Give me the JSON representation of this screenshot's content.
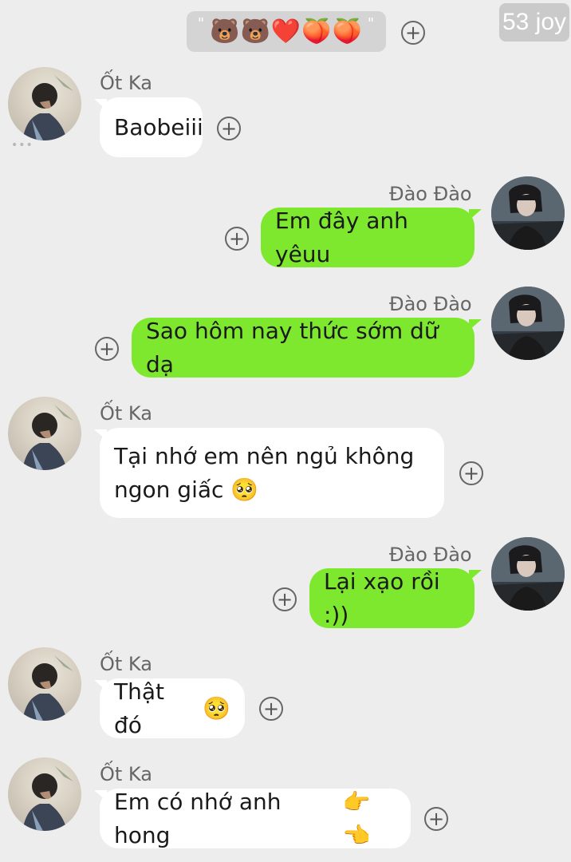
{
  "pinned": {
    "quote_open": "\"",
    "emojis": [
      "🐻",
      "🐻",
      "❤️",
      "🍑",
      "🍑"
    ],
    "quote_close": "\""
  },
  "watermark": {
    "text": "53 joy"
  },
  "contacts": {
    "left_name": "Ốt Ka",
    "right_name": "Đào Đào"
  },
  "messages": [
    {
      "from": "left",
      "name": "Ốt Ka",
      "text": "Baobeiii"
    },
    {
      "from": "right",
      "name": "Đào Đào",
      "text": "Em đây anh yêuu"
    },
    {
      "from": "right",
      "name": "Đào Đào",
      "text": "Sao hôm nay thức sớm dữ dạ"
    },
    {
      "from": "left",
      "name": "Ốt Ka",
      "line1": "Tại nhớ em nên ngủ không",
      "line2": "ngon giấc",
      "emoji": "🥺"
    },
    {
      "from": "right",
      "name": "Đào Đào",
      "text": "Lại xạo rồi :))"
    },
    {
      "from": "left",
      "name": "Ốt Ka",
      "text": "Thật đó",
      "emoji": "🥺"
    },
    {
      "from": "left",
      "name": "Ốt Ka",
      "text": "Em có nhớ anh hong",
      "emoji": "👉👈"
    }
  ],
  "icons": {
    "add": "plus-circle-icon",
    "more": "more-dots-icon"
  },
  "add_glyph": "+",
  "more_glyph": "•••",
  "colors": {
    "background": "#ededed",
    "incoming_bubble": "#ffffff",
    "outgoing_bubble": "#7ee82f",
    "pinned_bg": "#d4d4d4"
  }
}
